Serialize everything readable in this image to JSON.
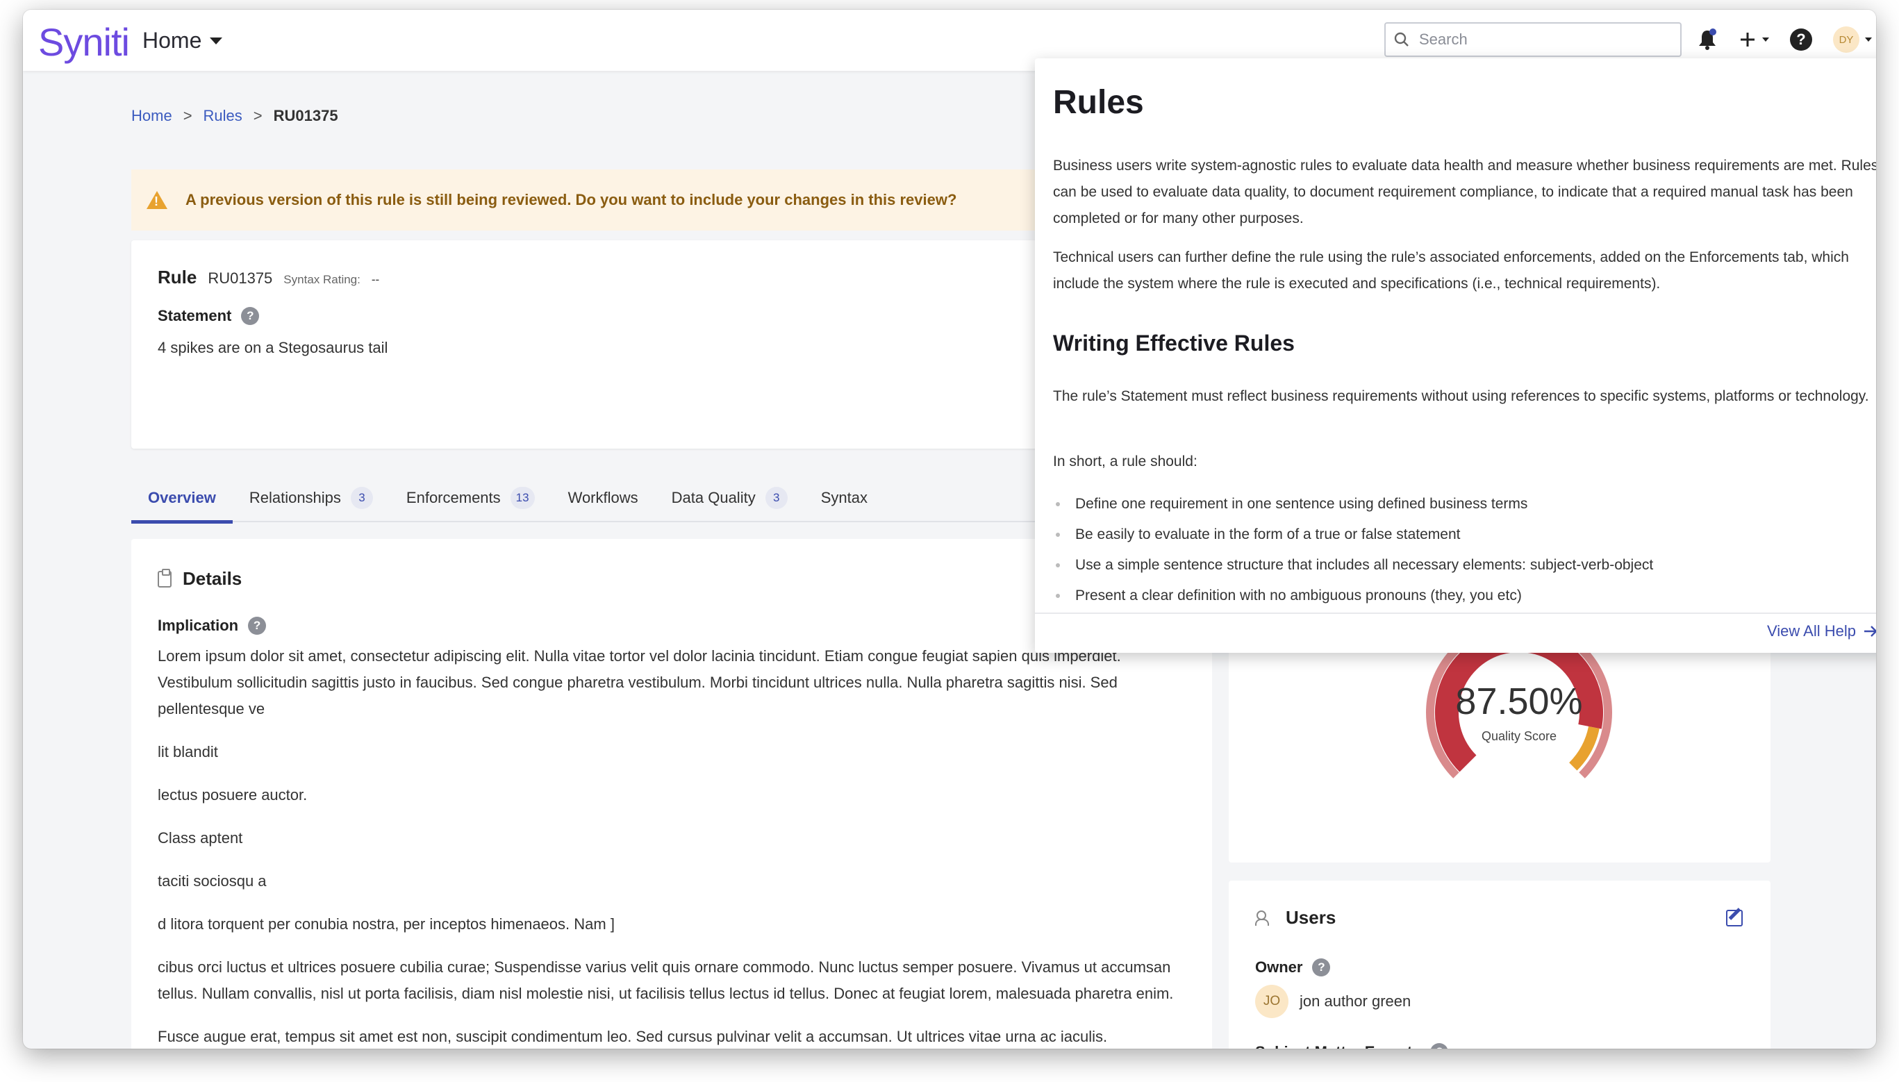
{
  "header": {
    "logo": "Syniti",
    "nav_label": "Home",
    "search_placeholder": "Search",
    "avatar_initials": "DY"
  },
  "breadcrumb": [
    "Home",
    "Rules",
    "RU01375"
  ],
  "breadcrumb_sep": ">",
  "banner": {
    "text": "A previous version of this rule is still being reviewed. Do you want to include your changes in this review?"
  },
  "rule": {
    "title": "Rule",
    "id": "RU01375",
    "syntax_label": "Syntax Rating:",
    "syntax_value": "--",
    "statement_label": "Statement",
    "statement_text": "4 spikes are on a Stegosaurus tail"
  },
  "tabs": [
    {
      "label": "Overview",
      "count": null
    },
    {
      "label": "Relationships",
      "count": "3"
    },
    {
      "label": "Enforcements",
      "count": "13"
    },
    {
      "label": "Workflows",
      "count": null
    },
    {
      "label": "Data Quality",
      "count": "3"
    },
    {
      "label": "Syntax",
      "count": null
    }
  ],
  "details": {
    "title": "Details",
    "implication_label": "Implication",
    "paragraphs": [
      "Lorem ipsum dolor sit amet, consectetur adipiscing elit. Nulla vitae tortor vel dolor lacinia tincidunt. Etiam congue feugiat sapien quis imperdiet. Vestibulum sollicitudin sagittis justo in faucibus. Sed congue pharetra vestibulum. Morbi tincidunt ultrices nulla. Nulla pharetra sagittis nisi. Sed pellentesque ve",
      "lit blandit",
      "lectus posuere auctor.",
      "Class aptent",
      "taciti sociosqu a",
      "d litora torquent per conubia nostra, per inceptos himenaeos. Nam ]",
      "cibus orci luctus et ultrices posuere cubilia curae; Suspendisse varius velit quis ornare commodo. Nunc luctus semper posuere. Vivamus ut accumsan tellus. Nullam convallis, nisl ut porta facilisis, diam nisl molestie nisi, ut facilisis tellus lectus id tellus. Donec at feugiat lorem, malesuada pharetra enim.",
      "Fusce augue erat, tempus sit amet est non, suscipit condimentum leo. Sed cursus pulvinar velit a accumsan. Ut ultrices vitae urna ac iaculis."
    ]
  },
  "score": {
    "value_text": "87.50%",
    "value": 87.5,
    "label": "Quality Score",
    "colors": {
      "main": "#c0343f",
      "light": "#d98a8c",
      "warn": "#e8a22f"
    }
  },
  "users": {
    "title": "Users",
    "owner_label": "Owner",
    "owner_initials": "JO",
    "owner_name": "jon author green",
    "sme_label": "Subject Matter Experts"
  },
  "help": {
    "title": "Rules",
    "p1": "Business users write system-agnostic rules to evaluate data health and measure whether business requirements are met. Rules can be used to evaluate data quality, to document requirement compliance, to indicate that a required manual task has been completed or for many other purposes.",
    "p2": "Technical users can further define the rule using the rule’s associated enforcements, added on the Enforcements tab, which include the system where the rule is executed and specifications (i.e., technical requirements).",
    "h2": "Writing Effective Rules",
    "p3": "The rule’s Statement must reflect business requirements without using references to specific systems, platforms or technology.",
    "p4": "In short, a rule should:",
    "list": [
      "Define one requirement in one sentence using defined business terms",
      "Be easily to evaluate in the form of a true or false statement",
      "Use a simple sentence structure that includes all necessary elements: subject-verb-object",
      "Present a clear definition with no ambiguous pronouns (they, you etc)"
    ],
    "view_all": "View All Help"
  },
  "colors": {
    "accent": "#3b4cae",
    "brand": "#6d4be0",
    "banner_bg": "#fdf3e4",
    "banner_text": "#8a5c10"
  },
  "icons": [
    "search-icon",
    "bell-icon",
    "plus-icon",
    "help-icon",
    "warning-icon",
    "clipboard-icon",
    "users-icon",
    "edit-icon",
    "arrow-right-icon"
  ]
}
